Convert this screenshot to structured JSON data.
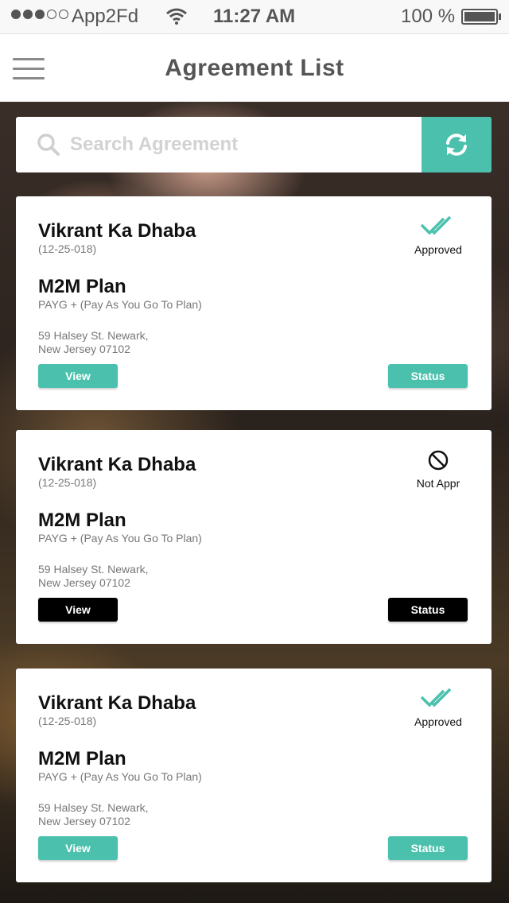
{
  "status_bar": {
    "carrier": "App2Fd",
    "time": "11:27 AM",
    "battery": "100 %",
    "signal_bars_filled": 3,
    "signal_bars_total": 5
  },
  "header": {
    "title": "Agreement List",
    "menu_icon": "hamburger-menu-icon"
  },
  "search": {
    "placeholder": "Search Agreement",
    "value": "",
    "search_icon": "search-icon",
    "refresh_icon": "refresh-icon"
  },
  "colors": {
    "accent": "#4bc1ad",
    "dark_button": "#000000",
    "text_primary": "#111111",
    "text_secondary": "#777777"
  },
  "agreements": [
    {
      "name": "Vikrant Ka Dhaba",
      "code": "(12-25-018)",
      "plan": "M2M Plan",
      "plan_desc": "PAYG + (Pay As You Go To Plan)",
      "address_line1": "59 Halsey St. Newark,",
      "address_line2": "New Jersey 07102",
      "status": "Approved",
      "status_icon": "double-check-icon",
      "view_label": "View",
      "status_label": "Status"
    },
    {
      "name": "Vikrant Ka Dhaba",
      "code": "(12-25-018)",
      "plan": "M2M Plan",
      "plan_desc": "PAYG + (Pay As You Go To Plan)",
      "address_line1": "59 Halsey St. Newark,",
      "address_line2": "New Jersey 07102",
      "status": "Not Appr",
      "status_icon": "prohibited-icon",
      "view_label": "View",
      "status_label": "Status"
    },
    {
      "name": "Vikrant Ka Dhaba",
      "code": "(12-25-018)",
      "plan": "M2M Plan",
      "plan_desc": "PAYG + (Pay As You Go To Plan)",
      "address_line1": "59 Halsey St. Newark,",
      "address_line2": "New Jersey 07102",
      "status": "Approved",
      "status_icon": "double-check-icon",
      "view_label": "View",
      "status_label": "Status"
    }
  ]
}
